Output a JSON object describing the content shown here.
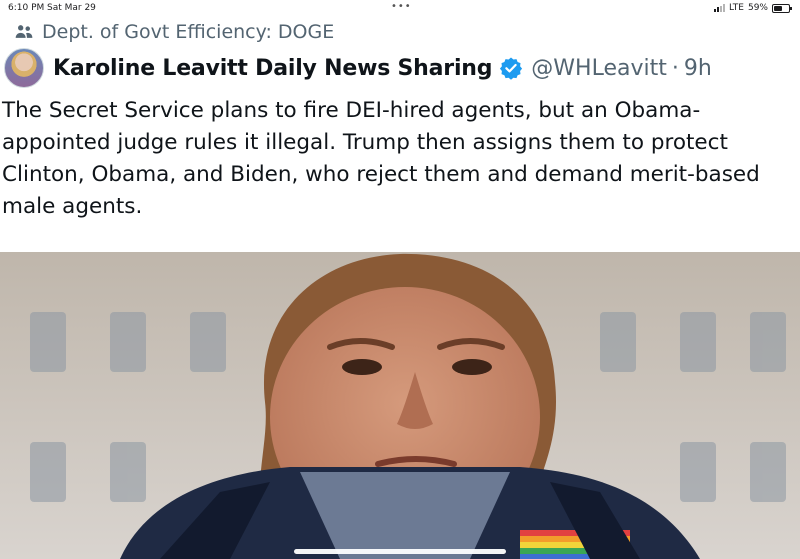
{
  "status_bar": {
    "time": "6:10 PM",
    "date": "Sat Mar 29",
    "dots": "•••",
    "network": "LTE",
    "battery": "59%"
  },
  "community": {
    "icon": "people-icon",
    "label": "Dept. of Govt Efficiency: DOGE"
  },
  "tweet": {
    "author_name": "Karoline Leavitt Daily News Sharing",
    "verified_icon": "verified-badge-icon",
    "handle": "@WHLeavitt",
    "separator": "·",
    "time_ago": "9h",
    "text": "The Secret Service plans to fire DEI-hired agents, but an Obama-appointed judge rules it illegal. Trump then assigns them to protect Clinton, Obama, and Biden, who reject them and demand merit-based male agents."
  },
  "colors": {
    "text": "#0f1419",
    "secondary": "#536471",
    "verified": "#1d9bf0"
  }
}
